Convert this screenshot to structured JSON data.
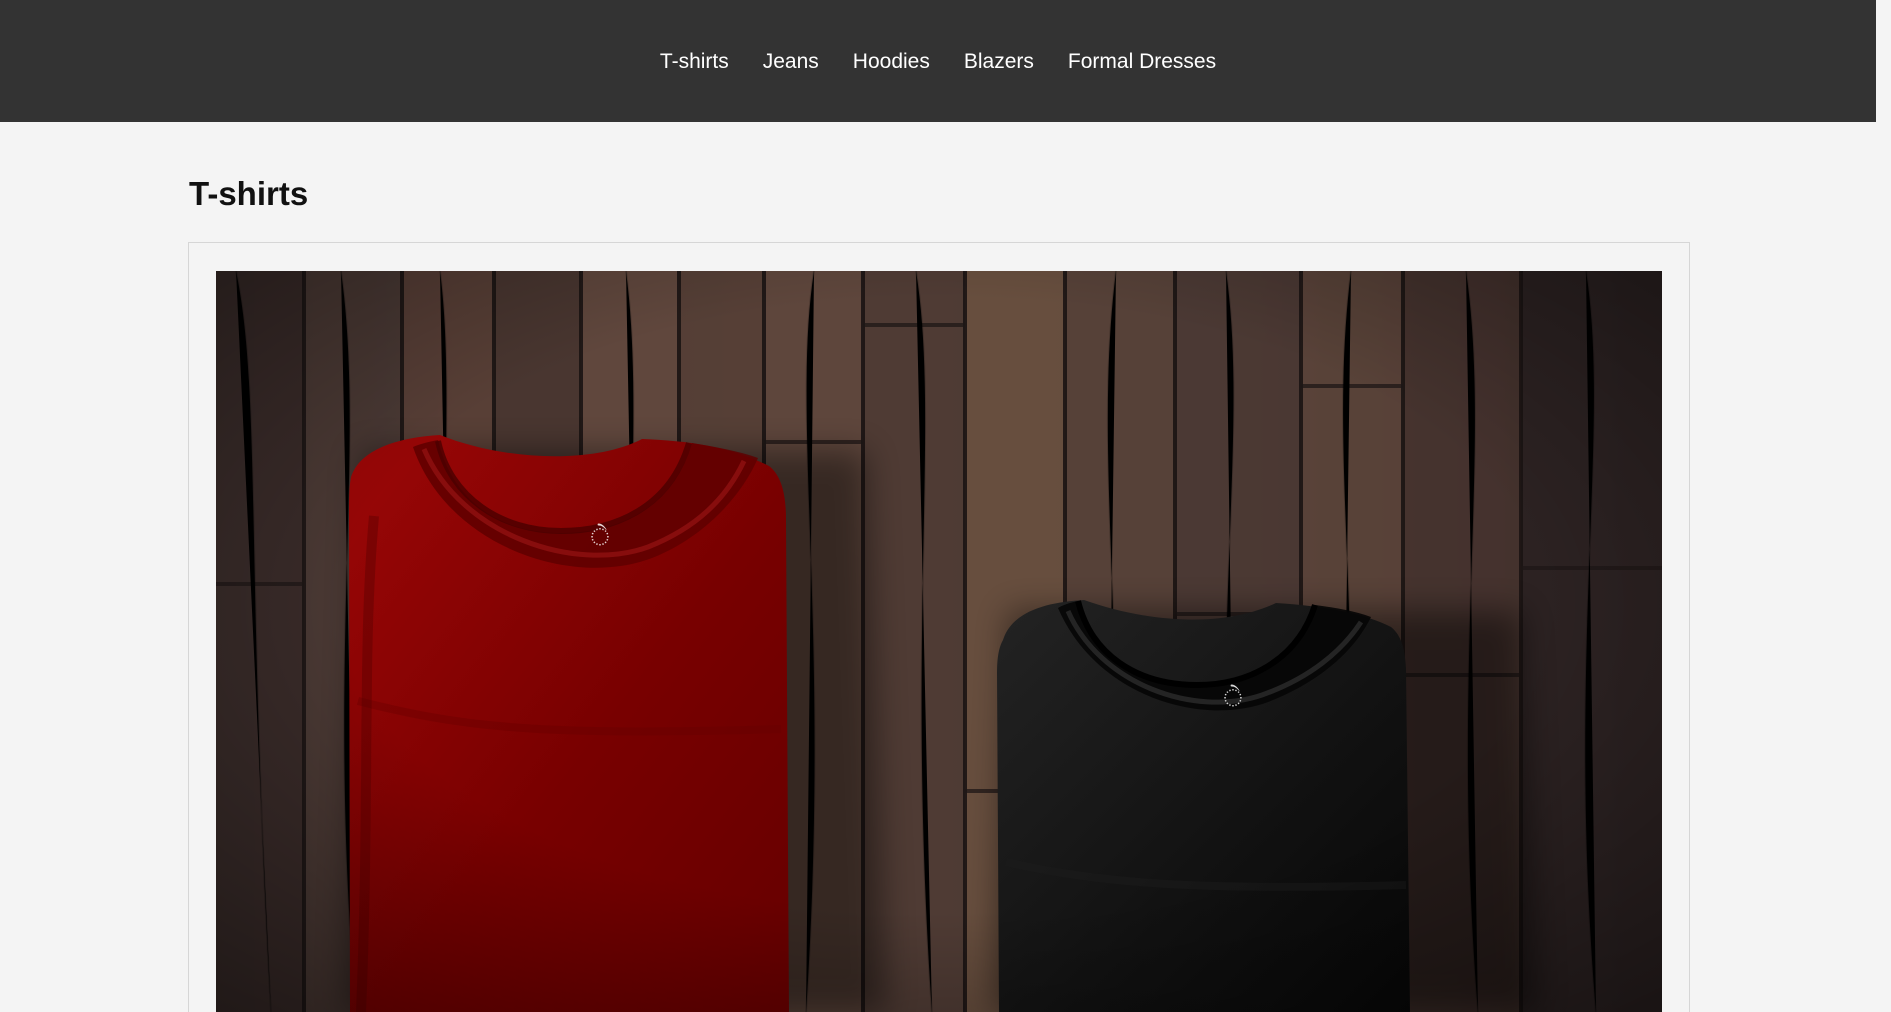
{
  "nav": {
    "items": [
      {
        "label": "T-shirts"
      },
      {
        "label": "Jeans"
      },
      {
        "label": "Hoodies"
      },
      {
        "label": "Blazers"
      },
      {
        "label": "Formal Dresses"
      }
    ]
  },
  "main": {
    "section_title": "T-shirts"
  },
  "colors": {
    "nav_background": "#333333",
    "page_background": "#f4f4f4",
    "red_tshirt": "#7a0000",
    "black_tshirt": "#111111",
    "wood": "#4a3730"
  }
}
